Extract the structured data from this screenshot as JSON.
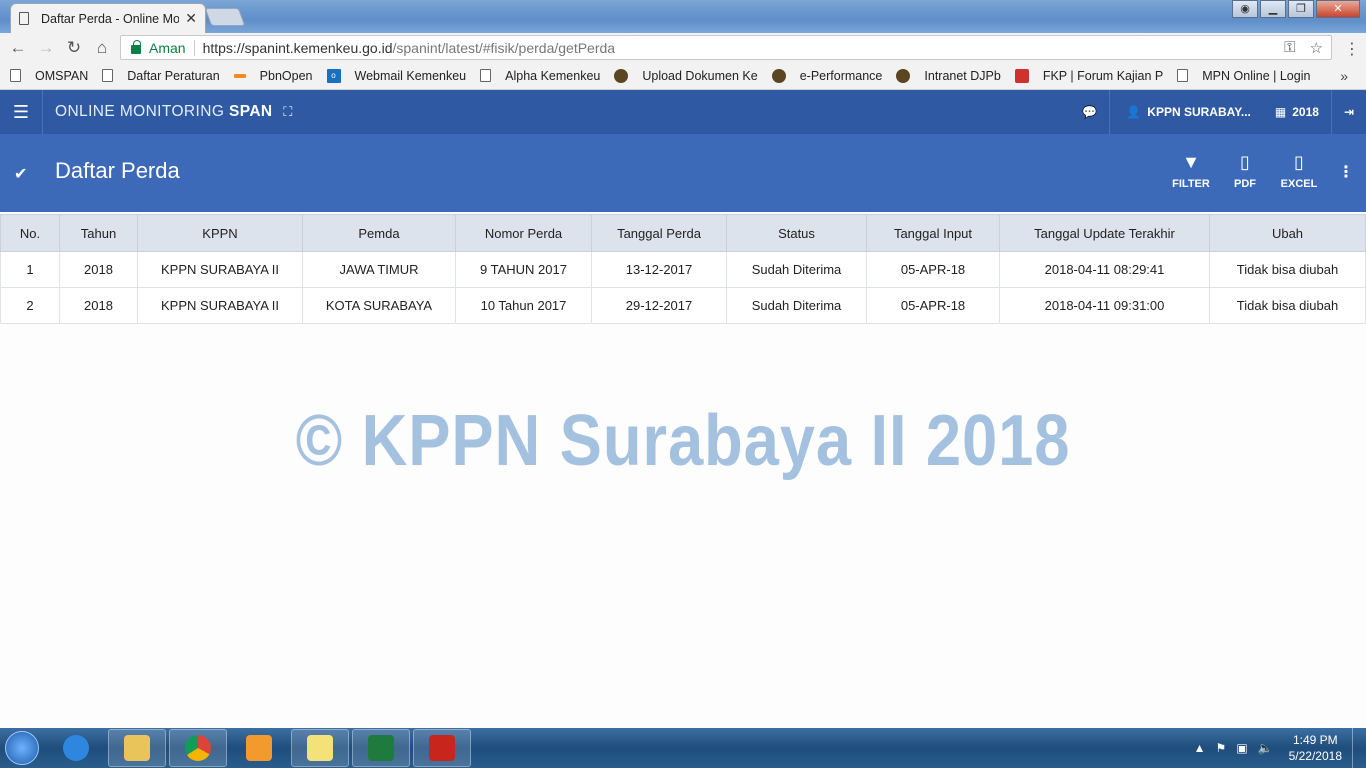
{
  "browser": {
    "tab_title": "Daftar Perda - Online Mo",
    "tab_close": "✕",
    "secure_label": "Aman",
    "url_host": "https://spanint.kemenkeu.go.id",
    "url_path": "/spanint/latest/#fisik/perda/getPerda",
    "bookmarks": [
      {
        "label": "OMSPAN",
        "icon": "page-icon"
      },
      {
        "label": "Daftar Peraturan",
        "icon": "page-icon"
      },
      {
        "label": "PbnOpen",
        "icon": "pbn-icon"
      },
      {
        "label": "Webmail Kemenkeu",
        "icon": "outlook-icon"
      },
      {
        "label": "Alpha Kemenkeu",
        "icon": "page-icon"
      },
      {
        "label": "Upload Dokumen Ke",
        "icon": "seal-icon"
      },
      {
        "label": "e-Performance",
        "icon": "seal-icon"
      },
      {
        "label": "Intranet DJPb",
        "icon": "seal-icon"
      },
      {
        "label": "FKP | Forum Kajian P",
        "icon": "fkp-icon"
      },
      {
        "label": "MPN Online | Login",
        "icon": "page-icon"
      }
    ],
    "bookmarks_more": "»"
  },
  "app": {
    "brand_prefix": "ONLINE MONITORING",
    "brand_bold": "SPAN",
    "user": "KPPN SURABAY...",
    "year": "2018"
  },
  "page": {
    "title": "Daftar Perda",
    "actions": [
      {
        "label": "FILTER",
        "icon": "filter-icon"
      },
      {
        "label": "PDF",
        "icon": "pdf-icon"
      },
      {
        "label": "EXCEL",
        "icon": "excel-icon"
      }
    ]
  },
  "table": {
    "headers": [
      "No.",
      "Tahun",
      "KPPN",
      "Pemda",
      "Nomor Perda",
      "Tanggal Perda",
      "Status",
      "Tanggal Input",
      "Tanggal Update Terakhir",
      "Ubah"
    ],
    "rows": [
      [
        "1",
        "2018",
        "KPPN SURABAYA II",
        "JAWA TIMUR",
        "9 TAHUN 2017",
        "13-12-2017",
        "Sudah Diterima",
        "05-APR-18",
        "2018-04-11 08:29:41",
        "Tidak bisa diubah"
      ],
      [
        "2",
        "2018",
        "KPPN SURABAYA II",
        "KOTA SURABAYA",
        "10 Tahun 2017",
        "29-12-2017",
        "Sudah Diterima",
        "05-APR-18",
        "2018-04-11 09:31:00",
        "Tidak bisa diubah"
      ]
    ]
  },
  "watermark": "© KPPN Surabaya II 2018",
  "taskbar": {
    "time": "1:49 PM",
    "date": "5/22/2018"
  },
  "colors": {
    "appbar": "#2f5aa3",
    "pagebar": "#3d6ab8",
    "watermark": "#a5c1e0"
  }
}
